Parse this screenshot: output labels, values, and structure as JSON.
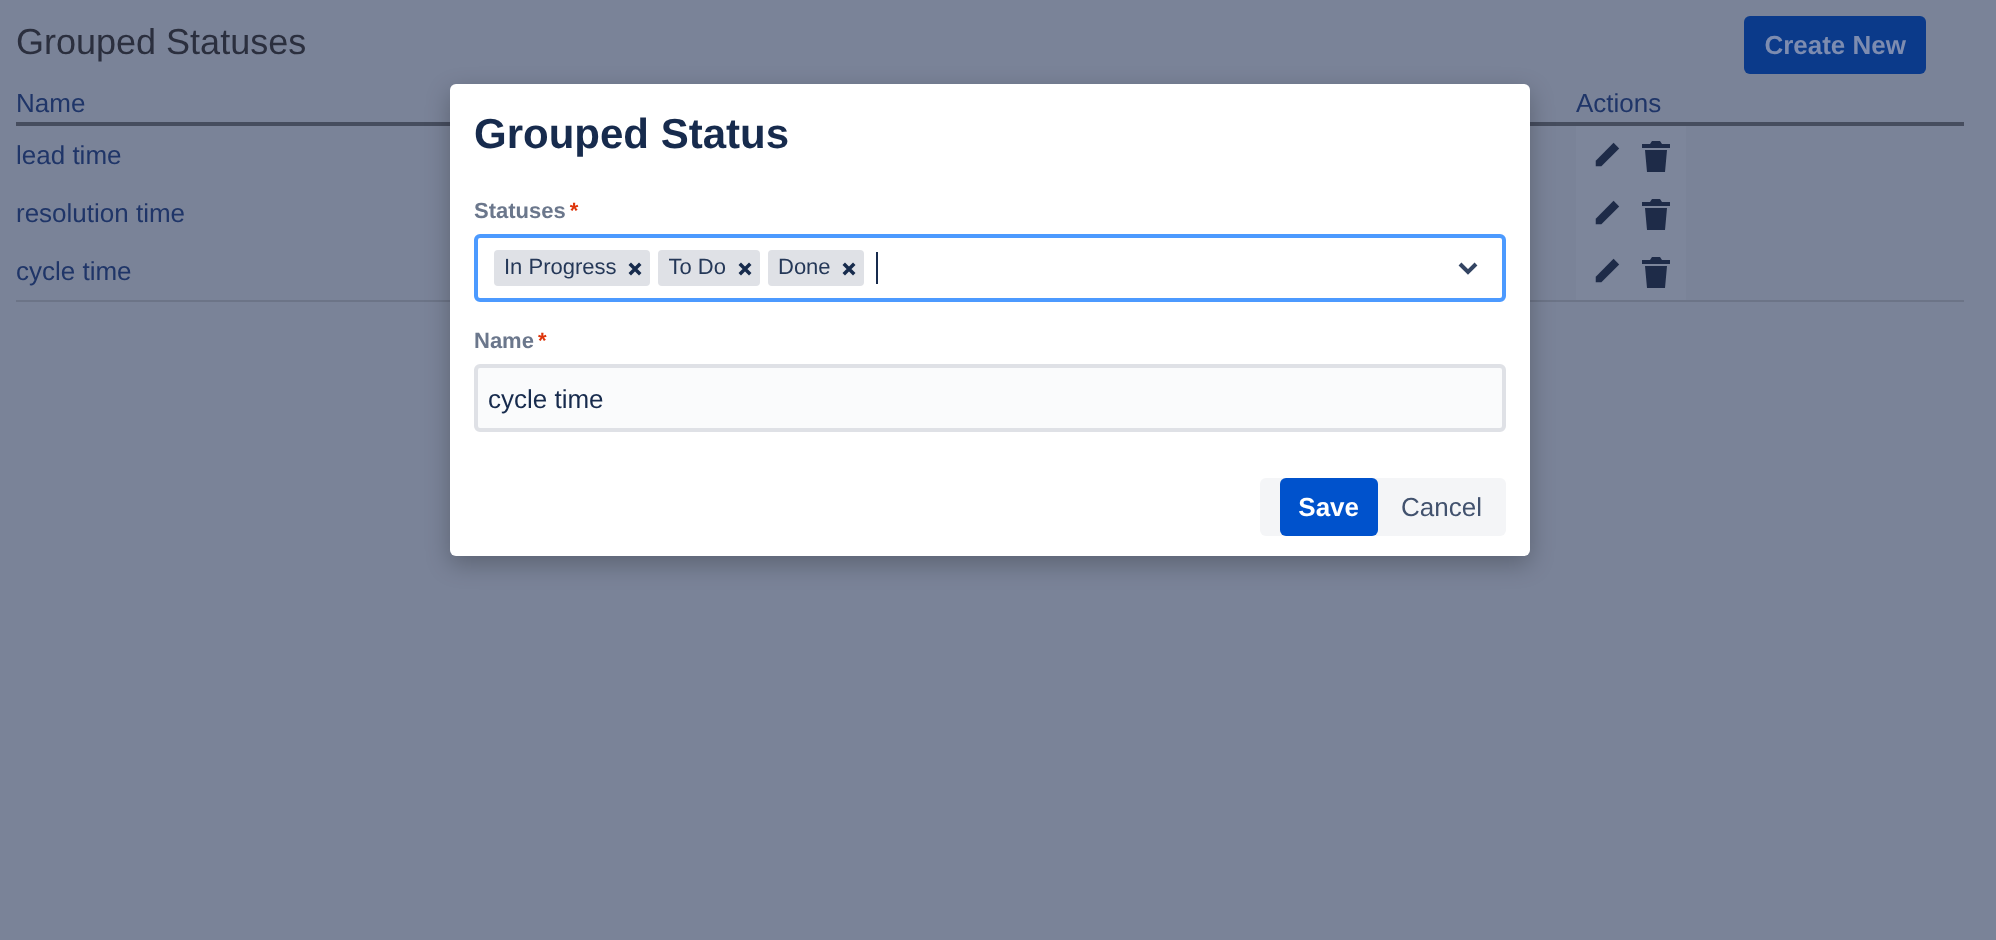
{
  "page": {
    "title": "Grouped Statuses",
    "create_button": "Create New"
  },
  "table": {
    "columns": [
      "Name",
      "Actions"
    ],
    "rows": [
      {
        "name": "lead time"
      },
      {
        "name": "resolution time"
      },
      {
        "name": "cycle time"
      }
    ]
  },
  "dialog": {
    "title": "Grouped Status",
    "statuses": {
      "label": "Statuses",
      "required_mark": "*",
      "tags": [
        "In Progress",
        "To Do",
        "Done"
      ]
    },
    "name": {
      "label": "Name",
      "required_mark": "*",
      "value": "cycle time"
    },
    "buttons": [
      {
        "label": "Save",
        "kind": "primary"
      },
      {
        "label": "Cancel",
        "kind": "subtle"
      }
    ]
  }
}
